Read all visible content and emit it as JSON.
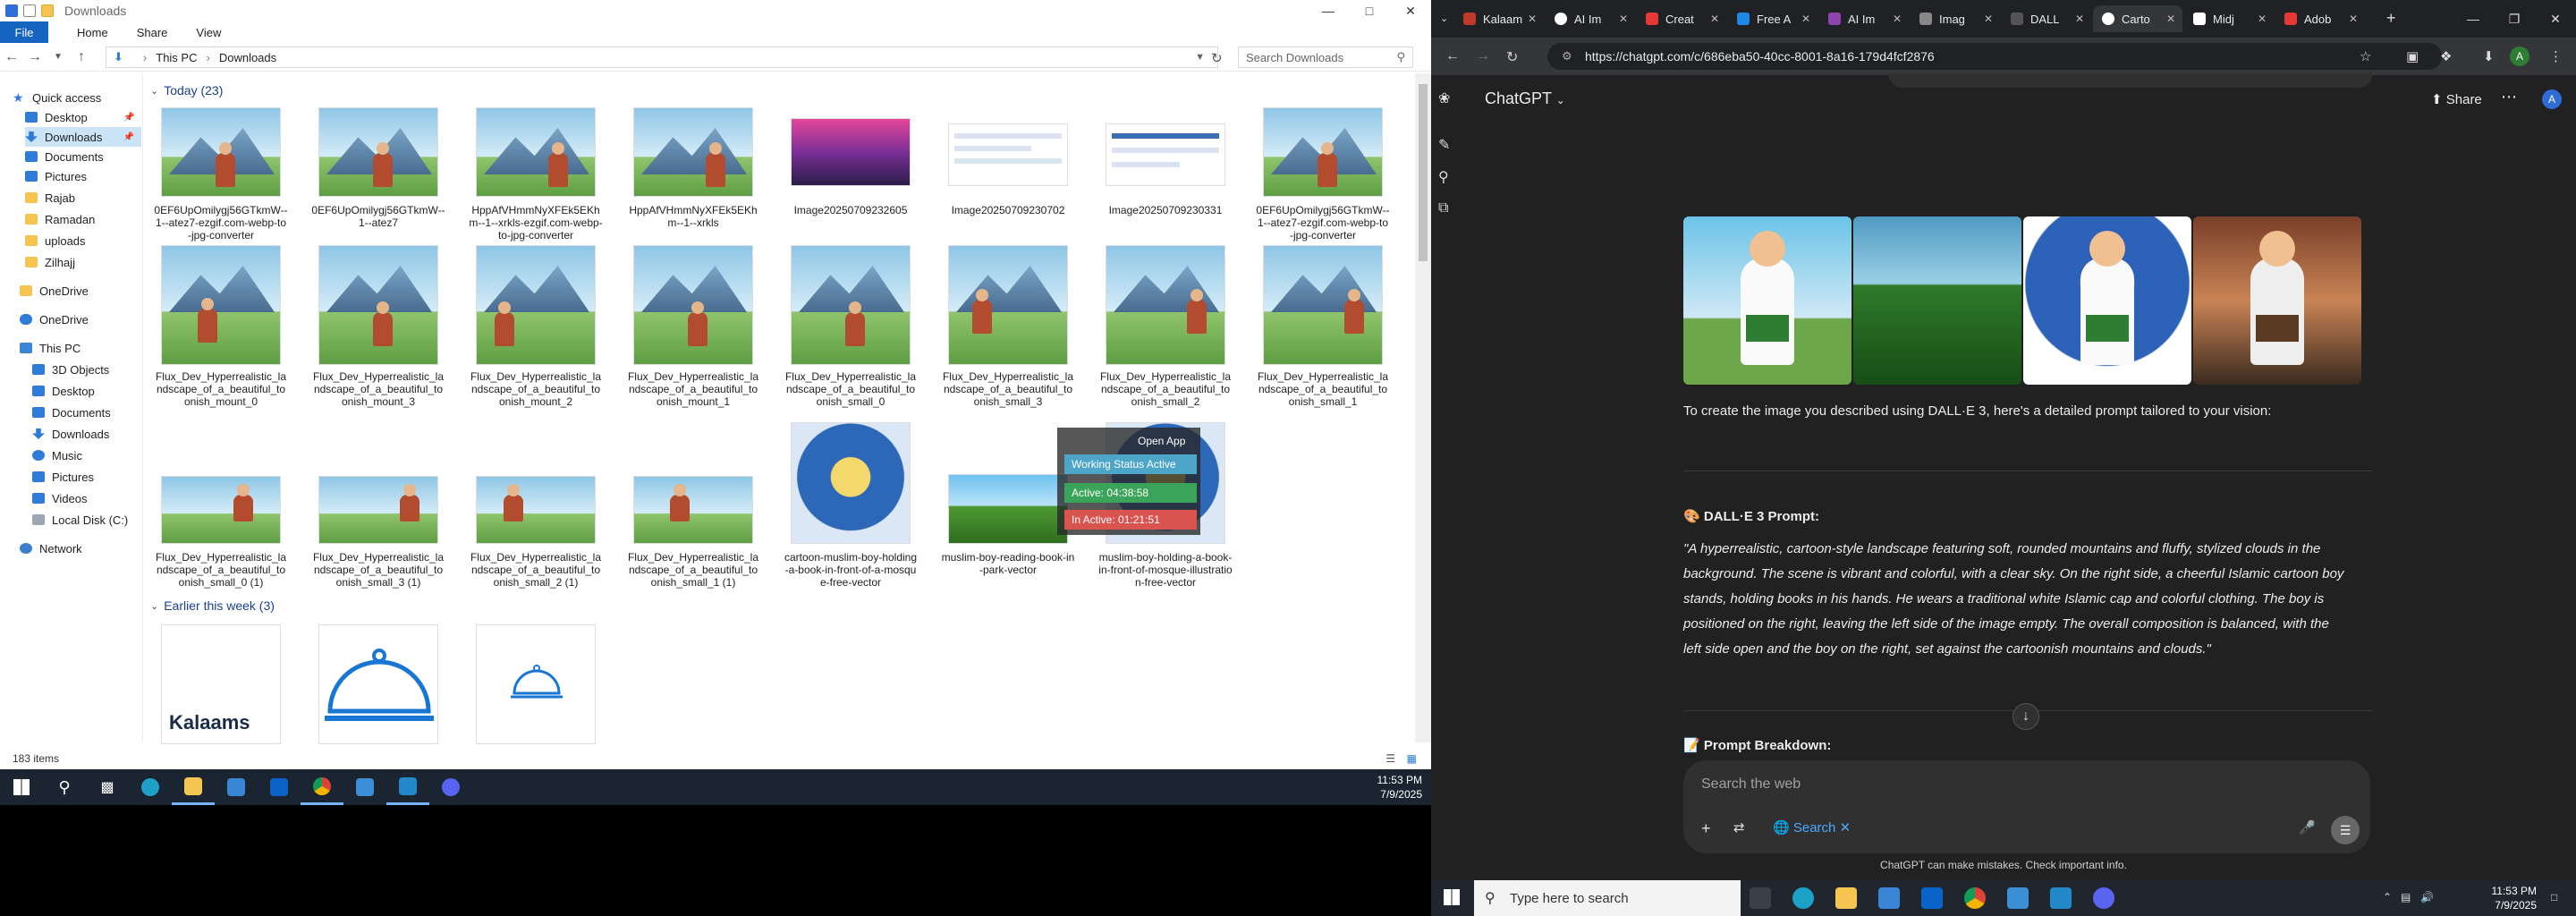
{
  "explorer": {
    "title": "Downloads",
    "ribbon": {
      "file": "File",
      "home": "Home",
      "share": "Share",
      "view": "View"
    },
    "path": [
      "This PC",
      "Downloads"
    ],
    "search_placeholder": "Search Downloads",
    "nav": [
      {
        "label": "Quick access"
      },
      {
        "label": "Desktop"
      },
      {
        "label": "Downloads"
      },
      {
        "label": "Documents"
      },
      {
        "label": "Pictures"
      },
      {
        "label": "Rajab"
      },
      {
        "label": "Ramadan"
      },
      {
        "label": "uploads"
      },
      {
        "label": "Zilhajj"
      },
      {
        "label": "OneDrive"
      },
      {
        "label": "OneDrive"
      },
      {
        "label": "This PC"
      },
      {
        "label": "3D Objects"
      },
      {
        "label": "Desktop"
      },
      {
        "label": "Documents"
      },
      {
        "label": "Downloads"
      },
      {
        "label": "Music"
      },
      {
        "label": "Pictures"
      },
      {
        "label": "Videos"
      },
      {
        "label": "Local Disk (C:)"
      },
      {
        "label": "Network"
      }
    ],
    "groups": {
      "today": "Today (23)",
      "earlier": "Earlier this week (3)"
    },
    "files": [
      "0EF6UpOmilygj56GTkmW--1--atez7-ezgif.com-webp-to-jpg-converter",
      "0EF6UpOmilygj56GTkmW--1--atez7",
      "HppAfVHmmNyXFEk5EKhm--1--xrkls-ezgif.com-webp-to-jpg-converter",
      "HppAfVHmmNyXFEk5EKhm--1--xrkls",
      "Image20250709232605",
      "Image20250709230702",
      "Image20250709230331",
      "0EF6UpOmilygj56GTkmW--1--atez7-ezgif.com-webp-to-jpg-converter",
      "Flux_Dev_Hyperrealistic_landscape_of_a_beautiful_toonish_mount_0",
      "Flux_Dev_Hyperrealistic_landscape_of_a_beautiful_toonish_mount_3",
      "Flux_Dev_Hyperrealistic_landscape_of_a_beautiful_toonish_mount_2",
      "Flux_Dev_Hyperrealistic_landscape_of_a_beautiful_toonish_mount_1",
      "Flux_Dev_Hyperrealistic_landscape_of_a_beautiful_toonish_small_0",
      "Flux_Dev_Hyperrealistic_landscape_of_a_beautiful_toonish_small_3",
      "Flux_Dev_Hyperrealistic_landscape_of_a_beautiful_toonish_small_2",
      "Flux_Dev_Hyperrealistic_landscape_of_a_beautiful_toonish_small_1",
      "Flux_Dev_Hyperrealistic_landscape_of_a_beautiful_toonish_small_0 (1)",
      "Flux_Dev_Hyperrealistic_landscape_of_a_beautiful_toonish_small_3 (1)",
      "Flux_Dev_Hyperrealistic_landscape_of_a_beautiful_toonish_small_2 (1)",
      "Flux_Dev_Hyperrealistic_landscape_of_a_beautiful_toonish_small_1 (1)",
      "cartoon-muslim-boy-holding-a-book-in-front-of-a-mosque-free-vector",
      "muslim-boy-reading-book-in-park-vector",
      "muslim-boy-holding-a-book-in-front-of-mosque-illustration-free-vector"
    ],
    "earlier_logo": "Kalaams",
    "status": "183 items",
    "overlay": {
      "open_app": "Open App",
      "working": "Working Status Active",
      "active": "Active: 04:38:58",
      "inactive": "In Active: 01:21:51"
    }
  },
  "taskbar_left": {
    "time": "11:53 PM",
    "date": "7/9/2025"
  },
  "browser": {
    "tabs": [
      {
        "label": "Kalaam",
        "color": "#c0392b"
      },
      {
        "label": "AI Im",
        "color": "#ffffff"
      },
      {
        "label": "Creat",
        "color": "#e53935"
      },
      {
        "label": "Free A",
        "color": "#1e88e5"
      },
      {
        "label": "AI Im",
        "color": "#8e44ad"
      },
      {
        "label": "Imag",
        "color": "#888888"
      },
      {
        "label": "DALL",
        "color": "#555555"
      },
      {
        "label": "Carto",
        "color": "#ffffff"
      },
      {
        "label": "Midj",
        "color": "#ffffff"
      },
      {
        "label": "Adob",
        "color": "#e53935"
      }
    ],
    "url": "https://chatgpt.com/c/686eba50-40cc-8001-8a16-179d4fcf2876",
    "profile": "A"
  },
  "chat": {
    "brand": "ChatGPT",
    "share": "Share",
    "avatar": "A",
    "intro": "To create the image you described using DALL·E 3, here's a detailed prompt tailored to your vision:",
    "prompt_heading": "DALL·E 3 Prompt:",
    "prompt_heading_icon": "🎨",
    "prompt_lines": [
      "\"A hyperrealistic, cartoon-style landscape featuring soft, rounded mountains and fluffy, stylized clouds in the",
      "background. The scene is vibrant and colorful, with a clear sky. On the right side, a cheerful Islamic cartoon boy",
      "stands, holding books in his hands. He wears a traditional white Islamic cap and colorful clothing. The boy is",
      "positioned on the right, leaving the left side of the image empty. The overall composition is balanced, with the",
      "left side open and the boy on the right, set against the cartoonish mountains and clouds.\""
    ],
    "breakdown_heading": "Prompt Breakdown:",
    "breakdown_icon": "📝",
    "composer_placeholder": "Search the web",
    "search_chip": "Search",
    "disclaimer": "ChatGPT can make mistakes. Check important info."
  },
  "taskbar_right": {
    "search_placeholder": "Type here to search",
    "time": "11:53 PM",
    "date": "7/9/2025"
  }
}
